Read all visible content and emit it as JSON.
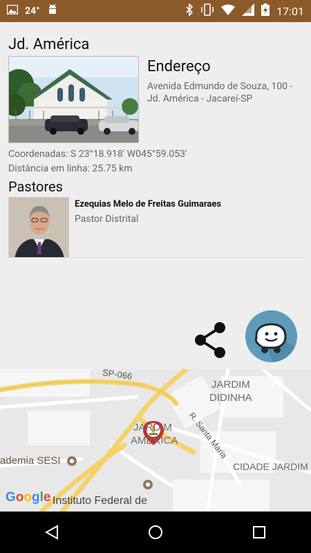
{
  "status_bar": {
    "temperature": "24°",
    "time": "17:01",
    "colors": {
      "background": "#8b5a2b"
    }
  },
  "church": {
    "name": "Jd. América",
    "address_title": "Endereço",
    "address": "Avenida Edmundo de Souza, 100 - Jd. América - Jacareí-SP",
    "coordinates": "Coordenadas: S 23°18.918' W045°59.053'",
    "distance": "Distância em linha: 25.75 km"
  },
  "pastors": {
    "title": "Pastores",
    "items": [
      {
        "name": "Ezequias Melo de Freitas Guimaraes",
        "role": "Pastor Distrital"
      }
    ]
  },
  "actions": {
    "share_icon": "share-icon",
    "waze_icon": "waze-icon",
    "waze_color": "#5e9bb8"
  },
  "map": {
    "labels": {
      "road": "SP-066",
      "jardim_didinha_1": "JARDIM",
      "jardim_didinha_2": "DIDINHA",
      "street": "R. Santa Maria",
      "jardim_america_1": "JARDIM",
      "jardim_america_2": "AMERICA",
      "sesi": "ademia SESI",
      "cidade_jardim": "CIDADE JARDIM",
      "instituto": "Instituto Federal de"
    },
    "google_logo": "Google"
  }
}
